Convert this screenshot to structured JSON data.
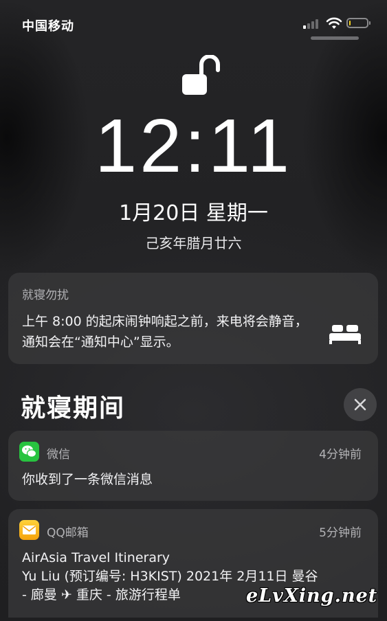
{
  "status_bar": {
    "carrier": "中国移动",
    "signal_bars_active": 1,
    "signal_bars_total": 4,
    "battery_level": 0.1,
    "battery_color": "#f5d11c"
  },
  "lock": {
    "icon": "unlocked-padlock-icon",
    "time": "12:11",
    "date": "1月20日 星期一",
    "lunar_date": "己亥年腊月廿六"
  },
  "dnd_card": {
    "title": "就寝勿扰",
    "body": "上午 8:00 的起床闹钟响起之前，来电将会静音，通知会在“通知中心”显示。",
    "icon": "bed-icon"
  },
  "section": {
    "title": "就寝期间",
    "clear_icon": "close-icon"
  },
  "notifications": [
    {
      "app": "微信",
      "icon": "wechat-icon",
      "time": "4分钟前",
      "body": "你收到了一条微信消息"
    },
    {
      "app": "QQ邮箱",
      "icon": "mail-icon",
      "time": "5分钟前",
      "body_lines": [
        "AirAsia Travel Itinerary",
        "Yu Liu (预订编号: H3KIST) 2021年 2月11日 曼谷",
        "- 廊曼 ✈ 重庆 - 旅游行程单"
      ]
    }
  ],
  "watermark": "eLvXing.net"
}
